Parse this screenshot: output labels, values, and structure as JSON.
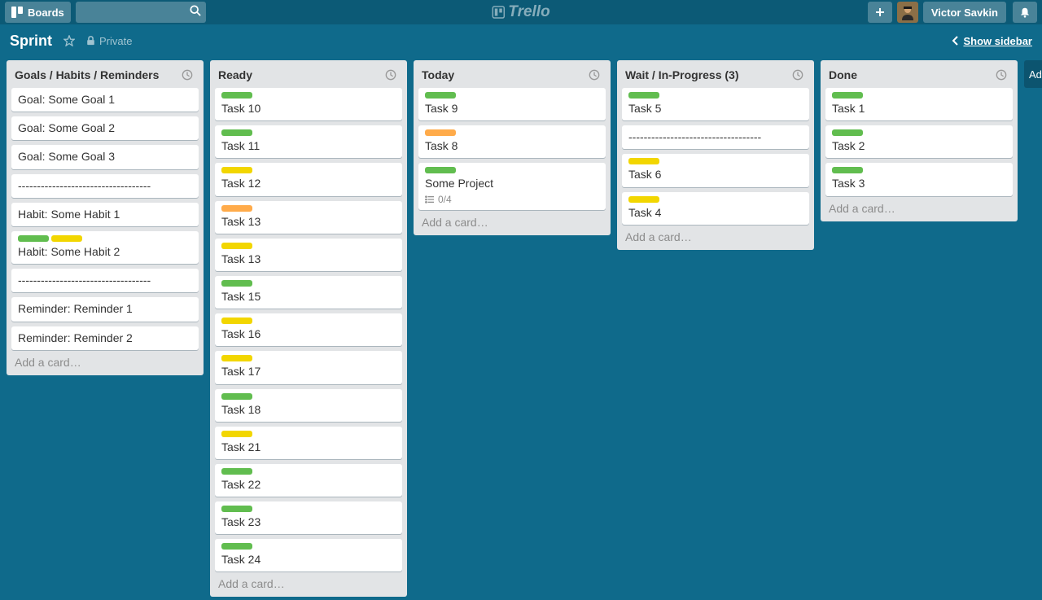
{
  "header": {
    "boards_label": "Boards",
    "search_placeholder": "",
    "logo_text": "Trello",
    "user_name": "Victor Savkin"
  },
  "board": {
    "name": "Sprint",
    "privacy_label": "Private",
    "show_sidebar_label": "Show sidebar",
    "add_list_label": "Ad"
  },
  "add_card_label": "Add a card…",
  "lists": [
    {
      "title": "Goals / Habits / Reminders",
      "cards": [
        {
          "labels": [],
          "title": "Goal: Some Goal 1"
        },
        {
          "labels": [],
          "title": "Goal: Some Goal 2"
        },
        {
          "labels": [],
          "title": "Goal: Some Goal 3"
        },
        {
          "labels": [],
          "title": "-----------------------------------"
        },
        {
          "labels": [],
          "title": "Habit: Some Habit 1"
        },
        {
          "labels": [
            "green",
            "yellow"
          ],
          "title": "Habit: Some Habit 2"
        },
        {
          "labels": [],
          "title": "-----------------------------------"
        },
        {
          "labels": [],
          "title": "Reminder: Reminder 1"
        },
        {
          "labels": [],
          "title": "Reminder: Reminder 2"
        }
      ]
    },
    {
      "title": "Ready",
      "cards": [
        {
          "labels": [
            "green"
          ],
          "title": "Task 10"
        },
        {
          "labels": [
            "green"
          ],
          "title": "Task 11"
        },
        {
          "labels": [
            "yellow"
          ],
          "title": "Task 12"
        },
        {
          "labels": [
            "orange"
          ],
          "title": "Task 13"
        },
        {
          "labels": [
            "yellow"
          ],
          "title": "Task 13"
        },
        {
          "labels": [
            "green"
          ],
          "title": "Task 15"
        },
        {
          "labels": [
            "yellow"
          ],
          "title": "Task 16"
        },
        {
          "labels": [
            "yellow"
          ],
          "title": "Task 17"
        },
        {
          "labels": [
            "green"
          ],
          "title": "Task 18"
        },
        {
          "labels": [
            "yellow"
          ],
          "title": "Task 21"
        },
        {
          "labels": [
            "green"
          ],
          "title": "Task 22"
        },
        {
          "labels": [
            "green"
          ],
          "title": "Task 23"
        },
        {
          "labels": [
            "green"
          ],
          "title": "Task 24"
        }
      ]
    },
    {
      "title": "Today",
      "cards": [
        {
          "labels": [
            "green"
          ],
          "title": "Task 9"
        },
        {
          "labels": [
            "orange"
          ],
          "title": "Task 8"
        },
        {
          "labels": [
            "green"
          ],
          "title": "Some Project",
          "checklist": "0/4"
        }
      ]
    },
    {
      "title": "Wait / In-Progress (3)",
      "cards": [
        {
          "labels": [
            "green"
          ],
          "title": "Task 5"
        },
        {
          "labels": [],
          "title": "-----------------------------------"
        },
        {
          "labels": [
            "yellow"
          ],
          "title": "Task 6"
        },
        {
          "labels": [
            "yellow"
          ],
          "title": "Task 4"
        }
      ]
    },
    {
      "title": "Done",
      "cards": [
        {
          "labels": [
            "green"
          ],
          "title": "Task 1"
        },
        {
          "labels": [
            "green"
          ],
          "title": "Task 2"
        },
        {
          "labels": [
            "green"
          ],
          "title": "Task 3"
        }
      ]
    }
  ]
}
